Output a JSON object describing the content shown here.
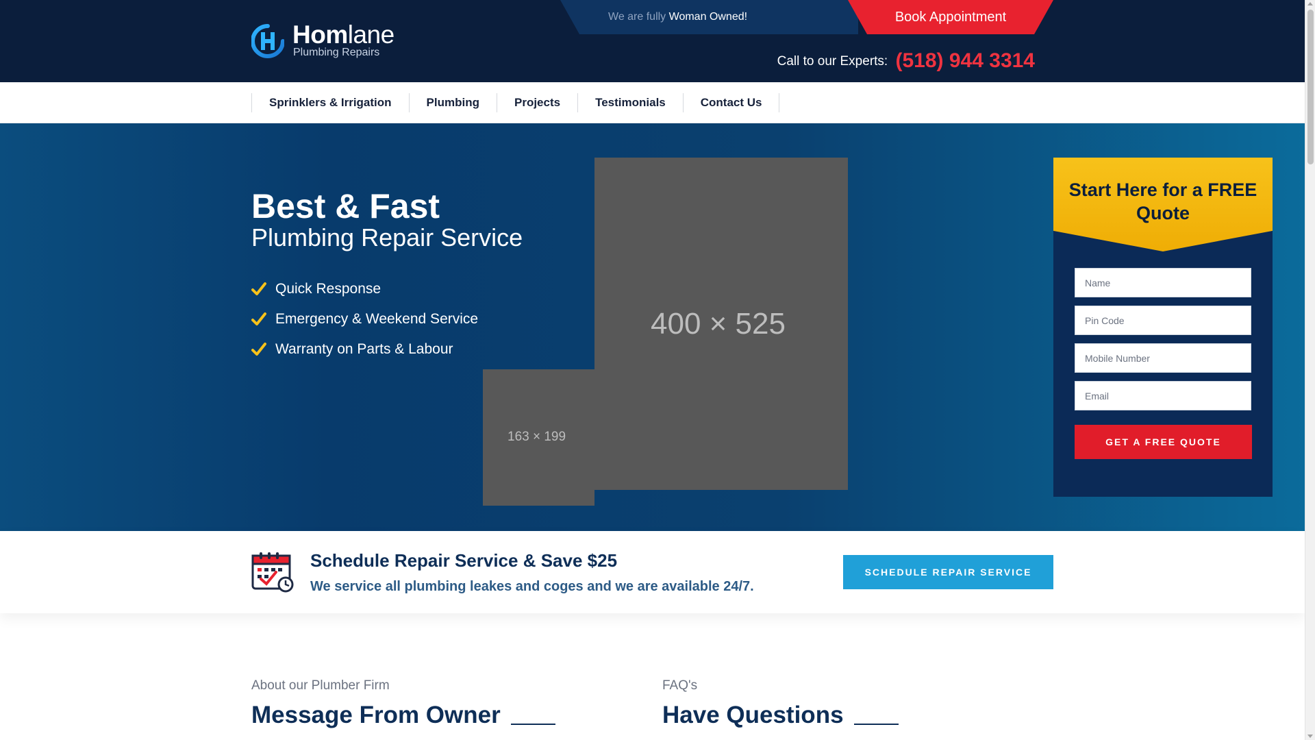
{
  "header": {
    "brand_bold": "Hom",
    "brand_light": "lane",
    "tagline": "Plumbing Repairs",
    "owned_prefix": "We are fully",
    "owned_highlight": "Woman Owned!",
    "book_label": "Book Appointment",
    "call_label": "Call to our Experts:",
    "phone": "(518) 944 3314"
  },
  "nav": {
    "items": [
      {
        "label": "Sprinklers & Irrigation"
      },
      {
        "label": "Plumbing"
      },
      {
        "label": "Projects"
      },
      {
        "label": "Testimonials"
      },
      {
        "label": "Contact Us"
      }
    ]
  },
  "hero": {
    "title": "Best & Fast",
    "subtitle": "Plumbing Repair Service",
    "features": [
      "Quick Response",
      "Emergency & Weekend Service",
      "Warranty on Parts & Labour"
    ],
    "placeholder_big": "400 × 525",
    "placeholder_small": "163 × 199"
  },
  "quote": {
    "title": "Start Here for a FREE Quote",
    "fields": [
      {
        "placeholder": "Name"
      },
      {
        "placeholder": "Pin Code"
      },
      {
        "placeholder": "Mobile Number"
      },
      {
        "placeholder": "Email"
      }
    ],
    "button": "GET A FREE QUOTE"
  },
  "schedule": {
    "title": "Schedule Repair Service & Save $25",
    "subtitle": "We service all plumbing leakes and coges and we are available 24/7.",
    "button": "SCHEDULE REPAIR SERVICE"
  },
  "about": {
    "eyebrow": "About our Plumber Firm",
    "heading": "Message From Owner"
  },
  "faq": {
    "eyebrow": "FAQ's",
    "heading": "Have Questions"
  },
  "colors": {
    "navy": "#0b1e3c",
    "red": "#e8222f",
    "yellow": "#f7c21a",
    "sky": "#20a0d8"
  }
}
